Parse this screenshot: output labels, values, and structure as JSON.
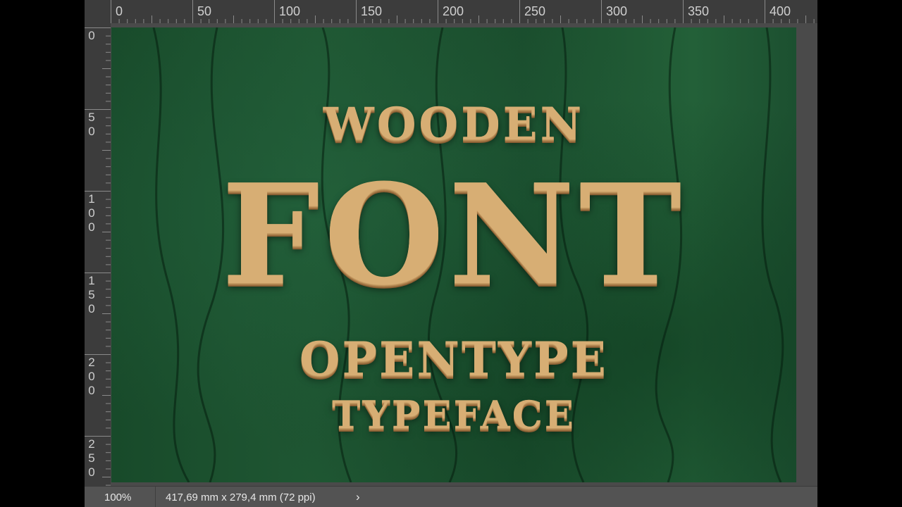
{
  "ruler": {
    "horizontal": [
      "0",
      "50",
      "100",
      "150",
      "200",
      "250",
      "300",
      "350",
      "400"
    ],
    "vertical": [
      "0",
      "50",
      "100",
      "150",
      "200",
      "250"
    ]
  },
  "canvas": {
    "line1": "WOODEN",
    "line2": "FONT",
    "line3": "OPENTYPE",
    "line4": "TYPEFACE",
    "background_color": "#1f5733",
    "wood_color": "#d7ae74"
  },
  "statusbar": {
    "zoom": "100%",
    "doc_info": "417,69 mm x 279,4 mm (72 ppi)",
    "arrow_icon": "›"
  }
}
